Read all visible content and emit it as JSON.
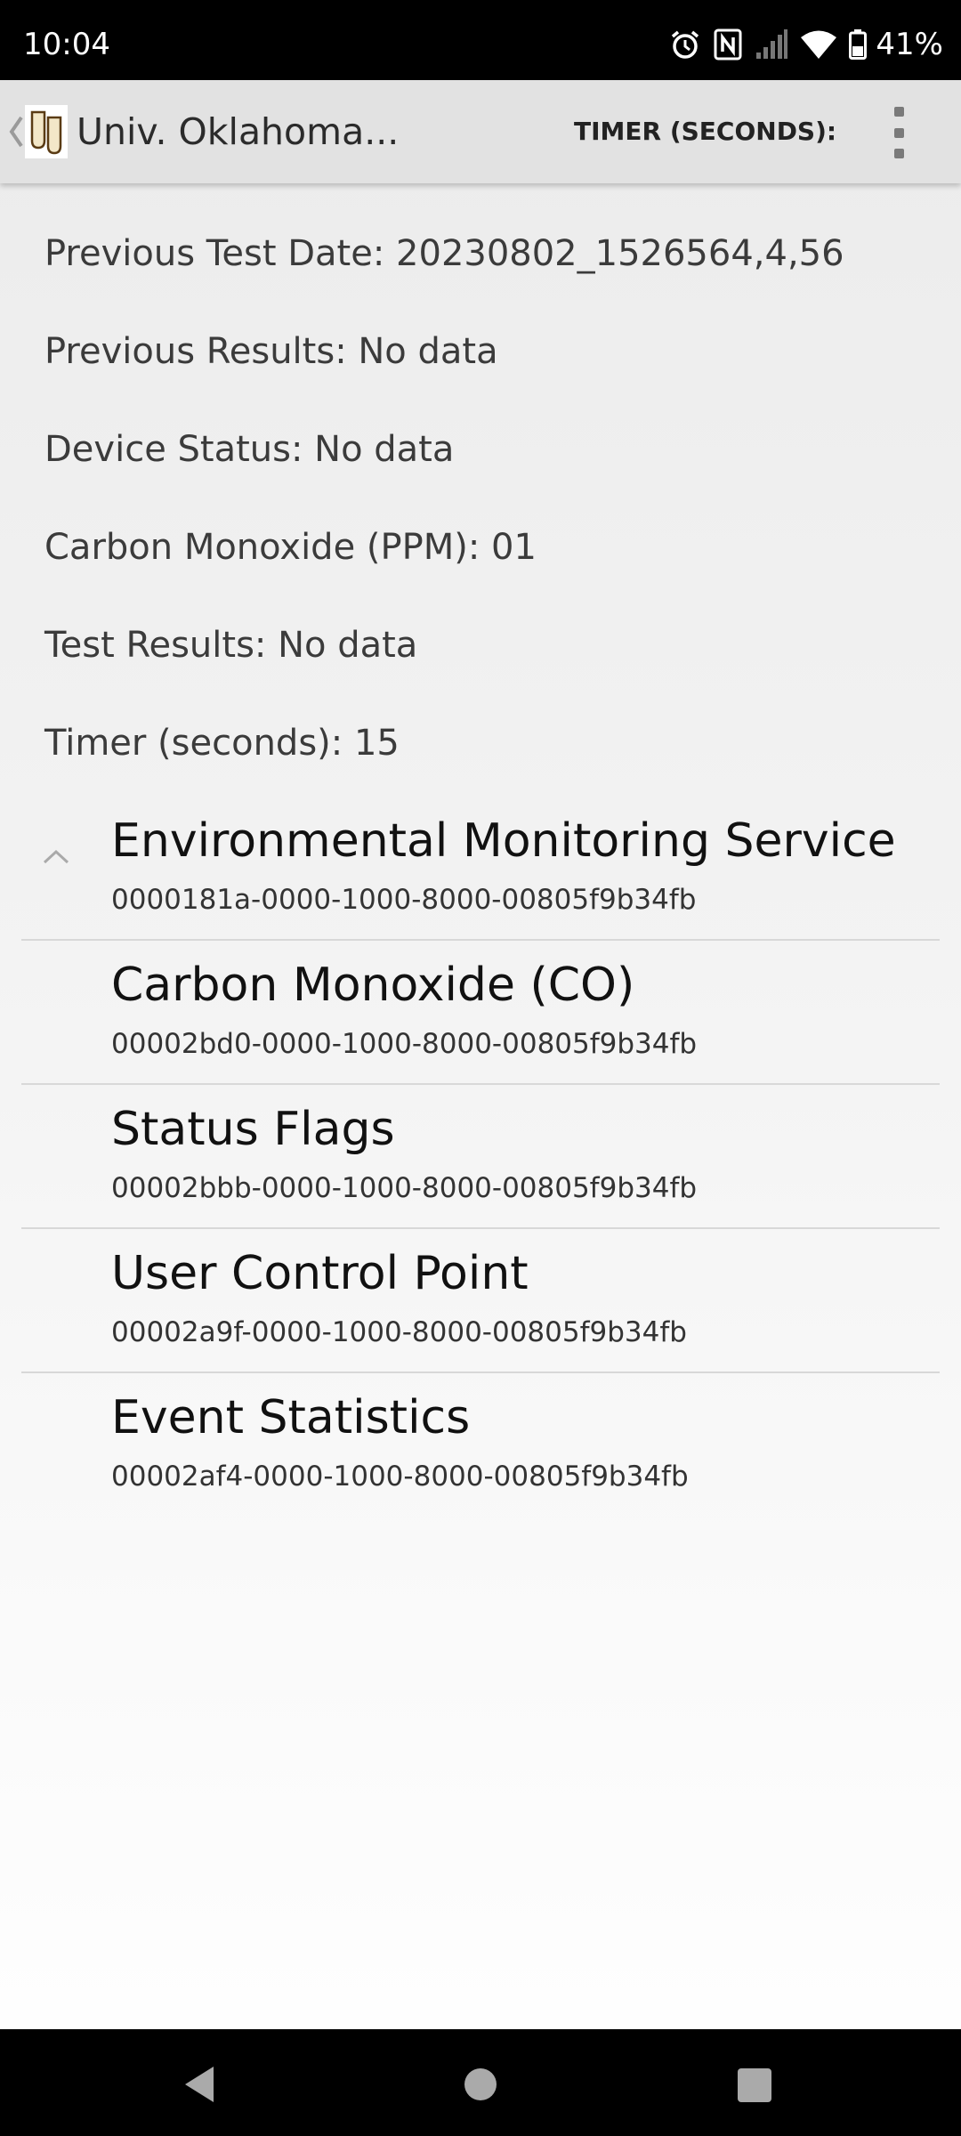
{
  "status_bar": {
    "time": "10:04",
    "battery": "41%",
    "icons": [
      "alarm-icon",
      "nfc-icon",
      "signal-icon",
      "wifi-icon",
      "battery-icon"
    ]
  },
  "app_bar": {
    "title": "Univ. Oklahoma...",
    "timer_label": "TIMER (SECONDS):",
    "icons": [
      "up-chevron-icon",
      "app-logo",
      "overflow-menu-icon"
    ]
  },
  "info": {
    "previous_test_date": "Previous Test Date: 20230802_1526564,4,56",
    "previous_results": "Previous Results: No data",
    "device_status": "Device Status: No data",
    "carbon_monoxide": "Carbon Monoxide (PPM): 01",
    "test_results": "Test Results: No data",
    "timer": "Timer (seconds): 15"
  },
  "services": [
    {
      "name": "Environmental Monitoring Service",
      "uuid": "0000181a-0000-1000-8000-00805f9b34fb",
      "expanded": true
    },
    {
      "name": "Carbon Monoxide (CO)",
      "uuid": "00002bd0-0000-1000-8000-00805f9b34fb"
    },
    {
      "name": "Status Flags",
      "uuid": "00002bbb-0000-1000-8000-00805f9b34fb"
    },
    {
      "name": "User Control Point",
      "uuid": "00002a9f-0000-1000-8000-00805f9b34fb"
    },
    {
      "name": "Event Statistics",
      "uuid": "00002af4-0000-1000-8000-00805f9b34fb"
    }
  ],
  "nav_bar": {
    "icons": [
      "back-icon",
      "home-icon",
      "recents-icon"
    ]
  }
}
